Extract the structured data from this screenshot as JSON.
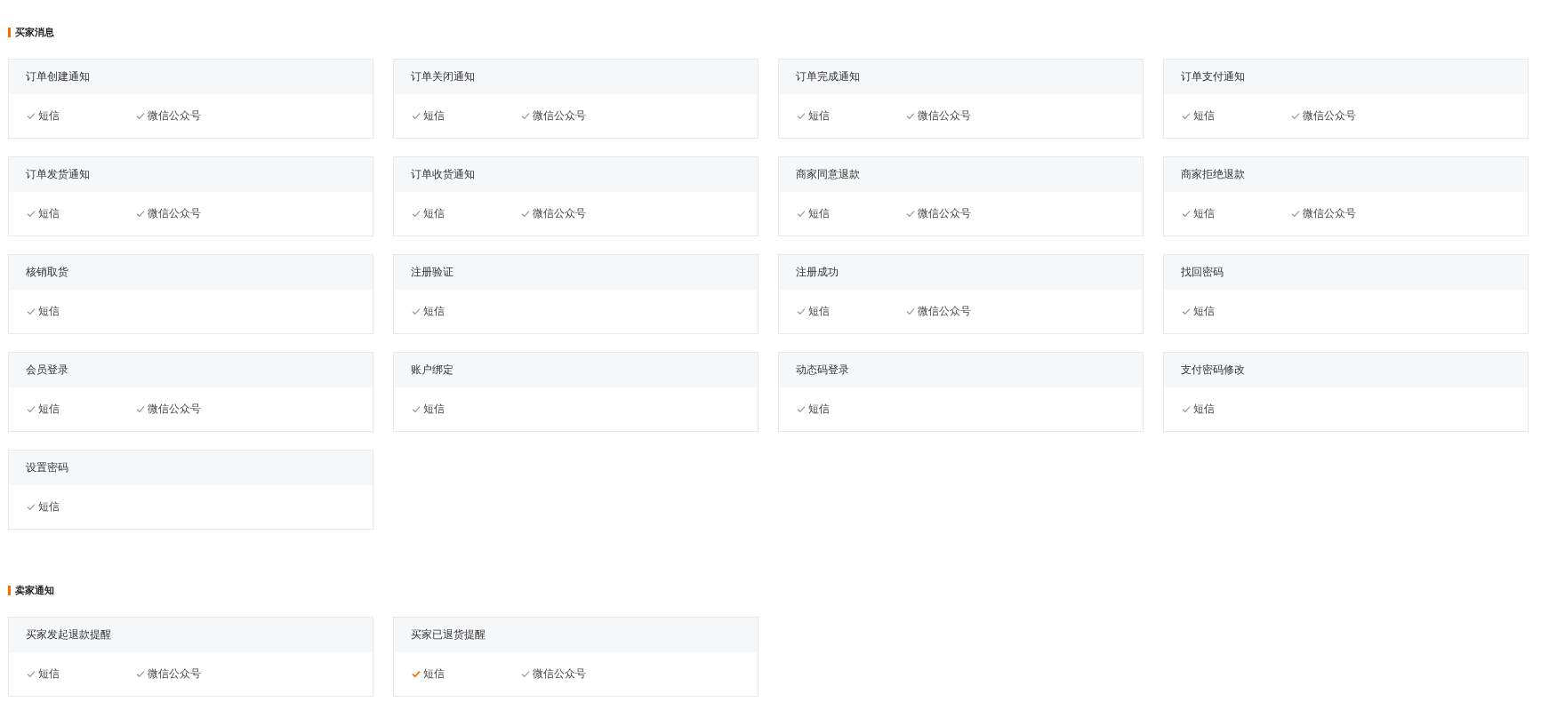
{
  "sections": [
    {
      "title": "买家消息",
      "cards": [
        {
          "title": "订单创建通知",
          "channels": [
            {
              "label": "短信",
              "highlighted": false
            },
            {
              "label": "微信公众号",
              "highlighted": false
            }
          ]
        },
        {
          "title": "订单关闭通知",
          "channels": [
            {
              "label": "短信",
              "highlighted": false
            },
            {
              "label": "微信公众号",
              "highlighted": false
            }
          ]
        },
        {
          "title": "订单完成通知",
          "channels": [
            {
              "label": "短信",
              "highlighted": false
            },
            {
              "label": "微信公众号",
              "highlighted": false
            }
          ]
        },
        {
          "title": "订单支付通知",
          "channels": [
            {
              "label": "短信",
              "highlighted": false
            },
            {
              "label": "微信公众号",
              "highlighted": false
            }
          ]
        },
        {
          "title": "订单发货通知",
          "channels": [
            {
              "label": "短信",
              "highlighted": false
            },
            {
              "label": "微信公众号",
              "highlighted": false
            }
          ]
        },
        {
          "title": "订单收货通知",
          "channels": [
            {
              "label": "短信",
              "highlighted": false
            },
            {
              "label": "微信公众号",
              "highlighted": false
            }
          ]
        },
        {
          "title": "商家同意退款",
          "channels": [
            {
              "label": "短信",
              "highlighted": false
            },
            {
              "label": "微信公众号",
              "highlighted": false
            }
          ]
        },
        {
          "title": "商家拒绝退款",
          "channels": [
            {
              "label": "短信",
              "highlighted": false
            },
            {
              "label": "微信公众号",
              "highlighted": false
            }
          ]
        },
        {
          "title": "核销取货",
          "channels": [
            {
              "label": "短信",
              "highlighted": false
            }
          ]
        },
        {
          "title": "注册验证",
          "channels": [
            {
              "label": "短信",
              "highlighted": false
            }
          ]
        },
        {
          "title": "注册成功",
          "channels": [
            {
              "label": "短信",
              "highlighted": false
            },
            {
              "label": "微信公众号",
              "highlighted": false
            }
          ]
        },
        {
          "title": "找回密码",
          "channels": [
            {
              "label": "短信",
              "highlighted": false
            }
          ]
        },
        {
          "title": "会员登录",
          "channels": [
            {
              "label": "短信",
              "highlighted": false
            },
            {
              "label": "微信公众号",
              "highlighted": false
            }
          ]
        },
        {
          "title": "账户绑定",
          "channels": [
            {
              "label": "短信",
              "highlighted": false
            }
          ]
        },
        {
          "title": "动态码登录",
          "channels": [
            {
              "label": "短信",
              "highlighted": false
            }
          ]
        },
        {
          "title": "支付密码修改",
          "channels": [
            {
              "label": "短信",
              "highlighted": false
            }
          ]
        },
        {
          "title": "设置密码",
          "channels": [
            {
              "label": "短信",
              "highlighted": false
            }
          ]
        }
      ]
    },
    {
      "title": "卖家通知",
      "cards": [
        {
          "title": "买家发起退款提醒",
          "channels": [
            {
              "label": "短信",
              "highlighted": false
            },
            {
              "label": "微信公众号",
              "highlighted": false
            }
          ]
        },
        {
          "title": "买家已退货提醒",
          "channels": [
            {
              "label": "短信",
              "highlighted": true
            },
            {
              "label": "微信公众号",
              "highlighted": false
            }
          ]
        }
      ]
    }
  ]
}
